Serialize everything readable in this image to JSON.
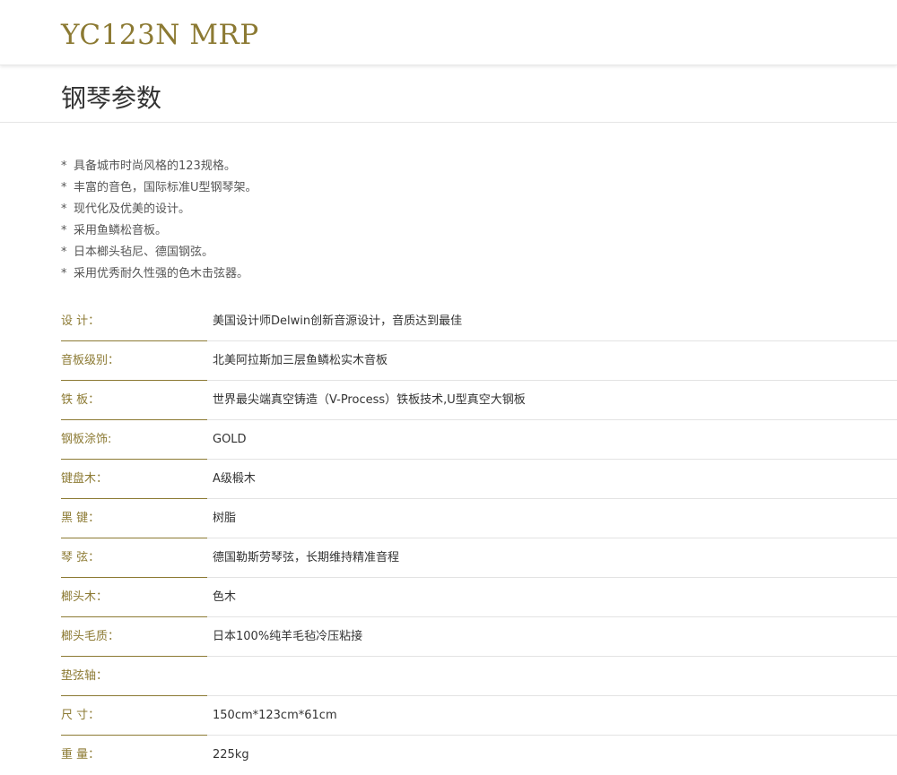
{
  "header": {
    "model": "YC123N MRP"
  },
  "section": {
    "title": "钢琴参数"
  },
  "features": [
    "具备城市时尚风格的123规格。",
    "丰富的音色，国际标准U型钢琴架。",
    "现代化及优美的设计。",
    "采用鱼鳞松音板。",
    "日本榔头毡尼、德国钢弦。",
    "采用优秀耐久性强的色木击弦器。"
  ],
  "bullet": "*",
  "specs": [
    {
      "label": "设 计：",
      "value": "美国设计师Delwin创新音源设计，音质达到最佳"
    },
    {
      "label": "音板级别：",
      "value": "北美阿拉斯加三层鱼鳞松实木音板"
    },
    {
      "label": "铁 板：",
      "value": "世界最尖端真空铸造（V-Process）铁板技术,U型真空大钢板"
    },
    {
      "label": "钢板涂饰:",
      "value": "GOLD"
    },
    {
      "label": "键盘木：",
      "value": "A级椴木"
    },
    {
      "label": "黑 键：",
      "value": "树脂"
    },
    {
      "label": "琴 弦：",
      "value": "德国勒斯劳琴弦，长期维持精准音程"
    },
    {
      "label": "榔头木：",
      "value": "色木"
    },
    {
      "label": "榔头毛质：",
      "value": "日本100%纯羊毛毡冷压粘接"
    },
    {
      "label": "垫弦轴：",
      "value": ""
    },
    {
      "label": "尺 寸：",
      "value": "150cm*123cm*61cm"
    },
    {
      "label": "重 量：",
      "value": "225kg"
    }
  ],
  "colors": {
    "accent": "#8c7a33",
    "text": "#333333",
    "divider": "#e3e3e3"
  }
}
